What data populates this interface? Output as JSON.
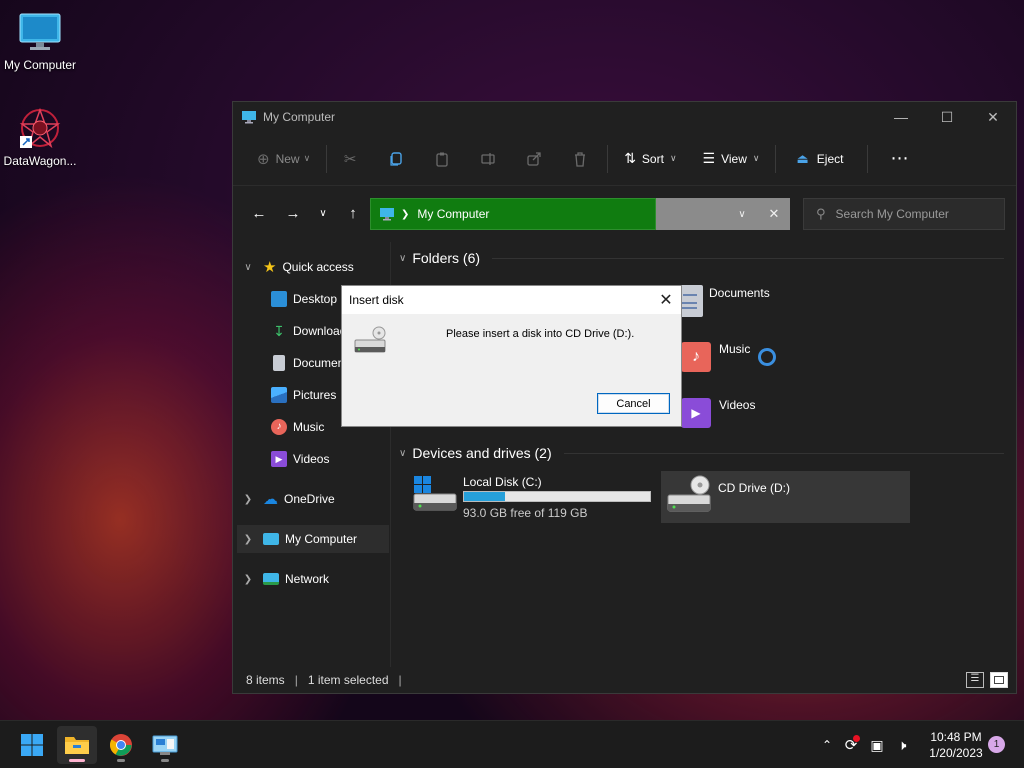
{
  "desktop": {
    "icons": [
      {
        "label": "My Computer",
        "icon": "monitor-icon"
      },
      {
        "label": "DataWagon...",
        "icon": "datawagon-icon"
      }
    ]
  },
  "window": {
    "title": "My Computer",
    "toolbar": {
      "new_label": "New",
      "sort_label": "Sort",
      "view_label": "View",
      "eject_label": "Eject"
    },
    "address": {
      "path_label": "My Computer"
    },
    "search": {
      "placeholder": "Search My Computer"
    },
    "sidebar": {
      "quick_access": "Quick access",
      "items": [
        {
          "label": "Desktop"
        },
        {
          "label": "Downloads"
        },
        {
          "label": "Documents"
        },
        {
          "label": "Pictures"
        },
        {
          "label": "Music"
        },
        {
          "label": "Videos"
        }
      ],
      "onedrive": "OneDrive",
      "my_computer": "My Computer",
      "network": "Network"
    },
    "content": {
      "folders_header": "Folders (6)",
      "folders": [
        {
          "label": "Documents"
        },
        {
          "label": "Music"
        },
        {
          "label": "Videos"
        }
      ],
      "devices_header": "Devices and drives (2)",
      "drives": [
        {
          "label": "Local Disk (C:)",
          "free_text": "93.0 GB free of 119 GB",
          "used_fraction": 0.22
        },
        {
          "label": "CD Drive (D:)"
        }
      ]
    },
    "status": {
      "items": "8 items",
      "selected": "1 item selected"
    }
  },
  "dialog": {
    "title": "Insert disk",
    "message": "Please insert a disk into CD Drive (D:).",
    "cancel_label": "Cancel"
  },
  "taskbar": {
    "time": "10:48 PM",
    "date": "1/20/2023",
    "notification_count": "1"
  },
  "colors": {
    "address_highlight": "#107c10",
    "accent": "#0067c0",
    "progress": "#26a0da"
  }
}
